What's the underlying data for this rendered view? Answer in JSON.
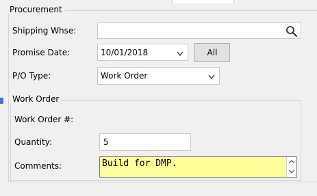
{
  "procurement": {
    "legend": "Procurement",
    "shipping_whse_label": "Shipping Whse:",
    "shipping_whse_value": "",
    "promise_date_label": "Promise Date:",
    "promise_date_value": "10/01/2018",
    "all_button": "All",
    "po_type_label": "P/O Type:",
    "po_type_value": "Work Order"
  },
  "work_order": {
    "legend": "Work Order",
    "number_label": "Work Order #:",
    "number_value": "",
    "quantity_label": "Quantity:",
    "quantity_value": "5",
    "comments_label": "Comments:",
    "comments_value": "Build for DMP."
  },
  "colors": {
    "window_bg": "#f0f0f0",
    "comments_bg": "#ffff99",
    "accent": "#3c78c8"
  },
  "icons": {
    "search": "search-icon",
    "dropdown": "chevron-down-icon",
    "scroll_up": "arrow-up-icon",
    "scroll_down": "arrow-down-icon"
  }
}
